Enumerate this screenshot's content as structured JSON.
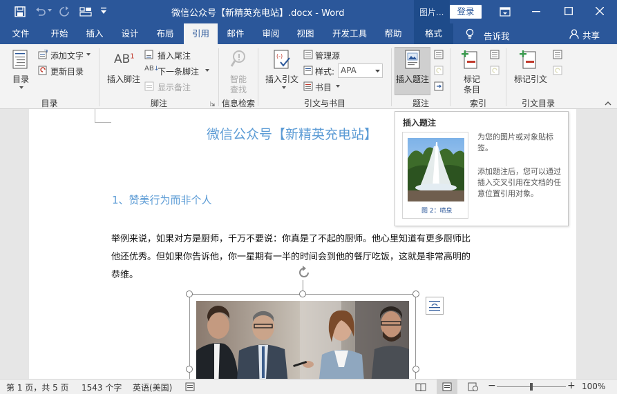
{
  "titlebar": {
    "title": "微信公众号【新精英充电站】.docx  -  Word",
    "context_tab": "图片...",
    "login": "登录"
  },
  "tabs": [
    "文件",
    "开始",
    "插入",
    "设计",
    "布局",
    "引用",
    "邮件",
    "审阅",
    "视图",
    "开发工具",
    "帮助",
    "格式"
  ],
  "tell_me": "告诉我",
  "share": "共享",
  "ribbon": {
    "toc": "目录",
    "add_text": "添加文字",
    "update_toc": "更新目录",
    "group_toc": "目录",
    "insert_footnote": "插入脚注",
    "insert_endnote": "插入尾注",
    "next_footnote": "下一条脚注",
    "show_notes": "显示备注",
    "group_footnote": "脚注",
    "smart_lookup_1": "智能",
    "smart_lookup_2": "查找",
    "group_research": "信息检索",
    "insert_citation": "插入引文",
    "manage_sources": "管理源",
    "style_label": "样式:",
    "style_value": "APA",
    "bibliography": "书目",
    "group_citations": "引文与书目",
    "insert_caption": "插入题注",
    "group_captions": "题注",
    "mark_entry_1": "标记",
    "mark_entry_2": "条目",
    "group_index": "索引",
    "mark_citation": "标记引文",
    "group_toa": "引文目录"
  },
  "document": {
    "title": "微信公众号【新精英充电站】",
    "heading": "1、赞美行为而非个人",
    "para_line1": "举例来说，如果对方是厨师，千万不要说：你真是了不起的厨师。他心里知道有更多厨师比",
    "para_line2": "他还优秀。但如果你告诉他，你一星期有一半的时间会到他的餐厅吃饭，这就是非常高明的",
    "para_line3": "恭维。"
  },
  "tooltip": {
    "title": "插入题注",
    "caption": "图 2：喷泉",
    "desc1": "为您的图片或对象贴标签。",
    "desc2": "添加题注后，您可以通过插入交叉引用在文档的任意位置引用对象。"
  },
  "status": {
    "page": "第 1 页，共 5 页",
    "words": "1543 个字",
    "lang": "英语(美国)",
    "zoom_minus": "−",
    "zoom_plus": "+",
    "zoom_value": "100%",
    "zoom_level": 1.0
  },
  "colors": {
    "brand": "#2b579a",
    "title_blue": "#5b9bd5"
  }
}
